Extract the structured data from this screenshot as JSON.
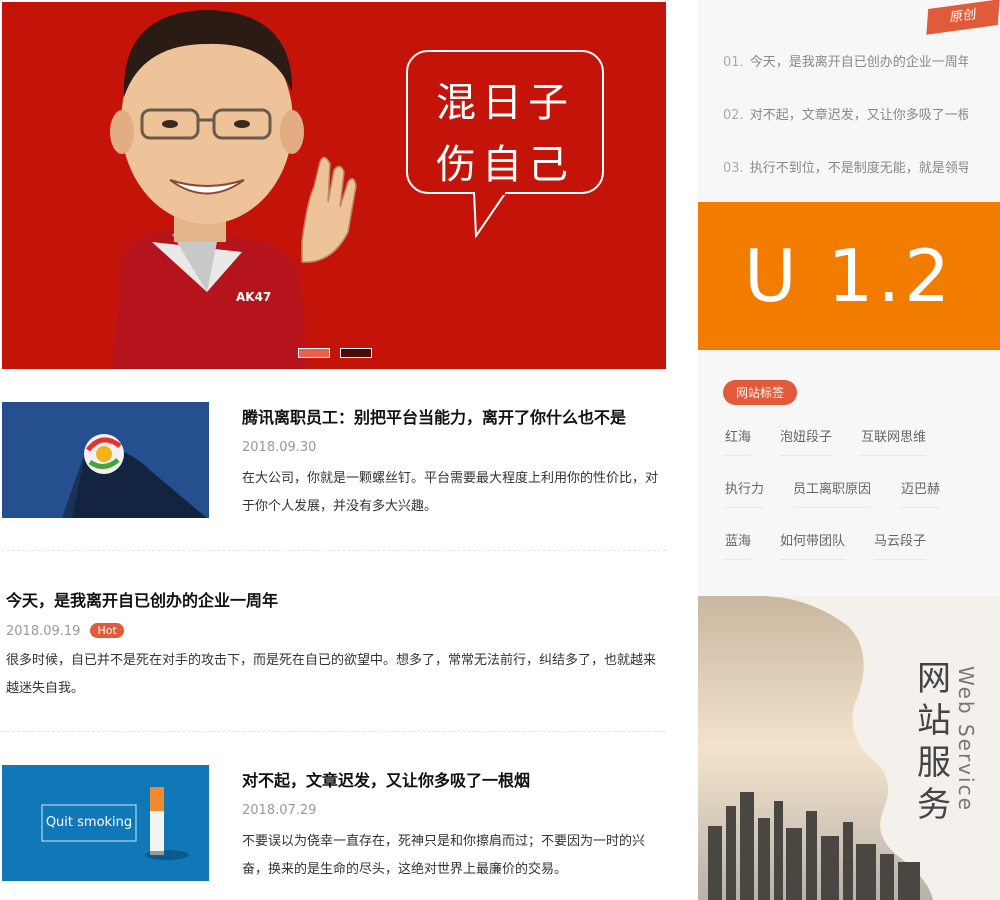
{
  "banner": {
    "bubble_line1": "混日子",
    "bubble_line2": "伤自己",
    "shirt_label": "AK47",
    "slides": [
      "slide-1",
      "slide-2"
    ],
    "active_slide": 1,
    "bg_color": "#c4140a"
  },
  "articles": [
    {
      "title": "腾讯离职员工：别把平台当能力，离开了你什么也不是",
      "date": "2018.09.30",
      "text": "在大公司，你就是一颗螺丝钉。平台需要最大程度上利用你的性价比，对于你个人发展，并没有多大兴趣。"
    },
    {
      "title": "今天，是我离开自已创办的企业一周年",
      "date": "2018.09.19",
      "badge": "Hot",
      "text": "很多时候，自已并不是死在对手的攻击下，而是死在自已的欲望中。想多了，常常无法前行，纠结多了，也就越来越迷失自我。"
    },
    {
      "title": "对不起，文章迟发，又让你多吸了一根烟",
      "date": "2018.07.29",
      "thumb_label": "Quit smoking",
      "text": "不要误以为侥幸一直存在，死神只是和你擦肩而过；不要因为一时的兴奋，换来的是生命的尽头，这绝对世界上最廉价的交易。"
    }
  ],
  "sidebar": {
    "original_label": "原创",
    "original_items": [
      {
        "num": "01.",
        "text": "今天，是我离开自已创办的企业一周年"
      },
      {
        "num": "02.",
        "text": "对不起，文章迟发，又让你多吸了一根烟"
      },
      {
        "num": "03.",
        "text": "执行不到位，不是制度无能，就是领导无能"
      }
    ],
    "version": "U 1.2",
    "tags_title": "网站标签",
    "tags": [
      "红海",
      "泡妞段子",
      "互联网思维",
      "执行力",
      "员工离职原因",
      "迈巴赫",
      "蓝海",
      "如何带团队",
      "马云段子"
    ],
    "service_cn": "网站服务",
    "service_en": "Web Service",
    "accent_color": "#e25a3a",
    "version_color": "#f17c00"
  }
}
